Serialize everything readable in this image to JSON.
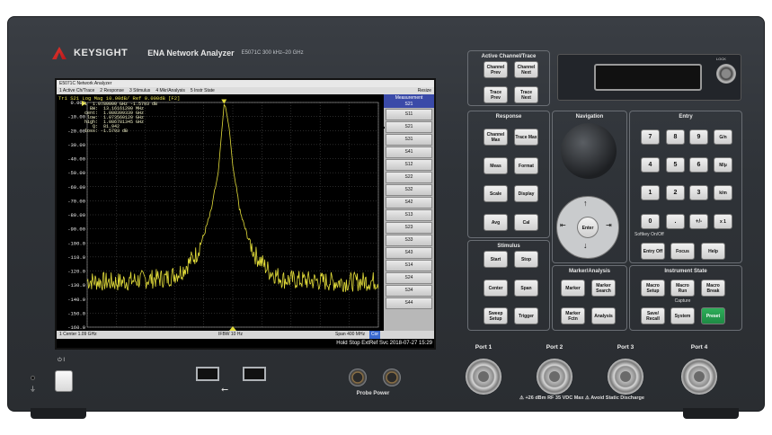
{
  "brand": {
    "company": "KEYSIGHT",
    "product": "ENA Network Analyzer",
    "model": "E5071C  300 kHz–20 GHz"
  },
  "screen": {
    "title": "E5071C Network Analyzer",
    "menu": [
      "1 Active Ch/Trace",
      "2 Response",
      "3 Stimulus",
      "4 Mkr/Analysis",
      "5 Instr State"
    ],
    "resize": "Resize",
    "trace_header": "Tr1  S21  Log Mag 10.00dB/ Ref 0.000dB [F2]",
    "marker_readout": "  >1  1.0780000 GHz -1.5793 dB\n     BW:  13.16161200 MHz\n   cent:  1.080399339 GHz\n    low:  1.073560120 GHz\n   high:  1.086781345 GHz\n      Q:  81.942\n   loss: -1.5793 dB",
    "y_ticks": [
      "0.000",
      "-10.00",
      "-20.00",
      "-30.00",
      "-40.00",
      "-50.00",
      "-60.00",
      "-70.00",
      "-80.00",
      "-90.00",
      "-100.0",
      "-110.0",
      "-120.0",
      "-130.0",
      "-140.0",
      "-150.0",
      "-160.0"
    ],
    "status_left": "1  Center 1.09 GHz",
    "status_mid": "IFBW 10 Hz",
    "status_right": "Span 400 MHz",
    "status_cor": "Cor",
    "bottom_bar": "Hold  Stop  ExtRef  Svc  2018-07-27 15:29",
    "meas_panel": {
      "title": "Measurement",
      "selected": "S21",
      "params": [
        "S11",
        "S21",
        "S31",
        "S41",
        "S12",
        "S22",
        "S32",
        "S42",
        "S13",
        "S23",
        "S33",
        "S43",
        "S14",
        "S24",
        "S34",
        "S44"
      ]
    }
  },
  "chart_data": {
    "type": "line",
    "title": "Tr1  S21  Log Mag 10.00dB/ Ref 0.000dB [F2]",
    "xlabel": "Center 1.09 GHz / Span 400 MHz",
    "ylabel": "dB",
    "ylim": [
      -160,
      0
    ],
    "xlim": [
      0.89,
      1.29
    ],
    "series": [
      {
        "name": "S21",
        "x": [
          0.89,
          0.93,
          0.97,
          1.0,
          1.02,
          1.04,
          1.05,
          1.06,
          1.07,
          1.075,
          1.078,
          1.08,
          1.085,
          1.09,
          1.1,
          1.11,
          1.12,
          1.14,
          1.16,
          1.2,
          1.24,
          1.29
        ],
        "values": [
          -127,
          -128,
          -126,
          -125,
          -120,
          -108,
          -95,
          -78,
          -50,
          -20,
          -1.6,
          -3,
          -18,
          -45,
          -78,
          -95,
          -108,
          -120,
          -126,
          -127,
          -128,
          -127
        ]
      }
    ],
    "marker": {
      "x": 1.078,
      "y": -1.5793
    }
  },
  "groups": {
    "active": "Active Channel/Trace",
    "response": "Response",
    "navigation": "Navigation",
    "entry": "Entry",
    "stimulus": "Stimulus",
    "marker": "Marker/Analysis",
    "instr": "Instrument State"
  },
  "keys": {
    "ch_prev": "Channel Prev",
    "ch_next": "Channel Next",
    "tr_prev": "Trace Prev",
    "tr_next": "Trace Next",
    "ch_max": "Channel Max",
    "tr_max": "Trace Max",
    "meas": "Meas",
    "format": "Format",
    "scale": "Scale",
    "display": "Display",
    "avg": "Avg",
    "cal": "Cal",
    "start": "Start",
    "stop": "Stop",
    "center": "Center",
    "span": "Span",
    "sweep": "Sweep Setup",
    "trigger": "Trigger",
    "marker": "Marker",
    "mksearch": "Marker Search",
    "mkfctn": "Marker Fctn",
    "analysis": "Analysis",
    "macro_setup": "Macro Setup",
    "macro_run": "Macro Run",
    "macro_break": "Macro Break",
    "capture": "Capture",
    "save": "Save/ Recall",
    "system": "System",
    "preset": "Preset",
    "n7": "7",
    "n8": "8",
    "n9": "9",
    "gn": "G/n",
    "n4": "4",
    "n5": "5",
    "n6": "6",
    "mu": "M/μ",
    "n1": "1",
    "n2": "2",
    "n3": "3",
    "km": "k/m",
    "n0": "0",
    "dot": ".",
    "pm": "+/-",
    "x1": "x 1",
    "softkey": "Softkey On/Off",
    "entry_off": "Entry Off",
    "focus": "Focus",
    "help": "Help",
    "enter": "Enter"
  },
  "ports": [
    "Port 1",
    "Port 2",
    "Port 3",
    "Port 4"
  ],
  "port_warning": "⚠ +26 dBm RF  35 VDC Max   ⚠ Avoid Static Discharge",
  "probe": "Probe Power",
  "lock": "LOCK"
}
